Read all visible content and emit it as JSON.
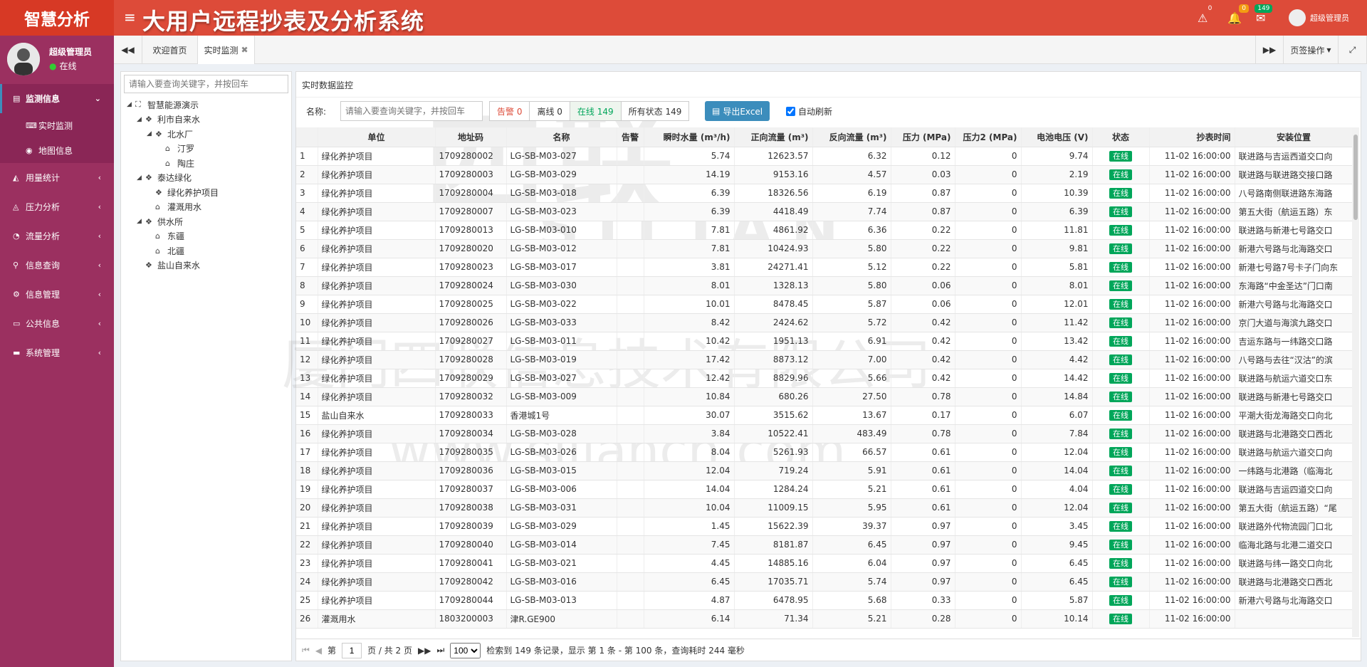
{
  "header": {
    "logo": "智慧分析",
    "title": "大用户远程抄表及分析系统",
    "user": "超级管理员",
    "badges": {
      "warn": "0",
      "bell": "0",
      "mail": "149"
    }
  },
  "sidebar": {
    "user_name": "超级管理员",
    "user_status": "在线",
    "items": [
      {
        "label": "监测信息",
        "icon": "book-icon",
        "active": true
      },
      {
        "label": "实时监测",
        "icon": "keyboard-icon",
        "sub": true
      },
      {
        "label": "地图信息",
        "icon": "globe-icon",
        "sub": true
      },
      {
        "label": "用量统计",
        "icon": "area-chart-icon"
      },
      {
        "label": "压力分析",
        "icon": "line-chart-icon"
      },
      {
        "label": "流量分析",
        "icon": "pie-chart-icon"
      },
      {
        "label": "信息查询",
        "icon": "search-icon"
      },
      {
        "label": "信息管理",
        "icon": "cogs-icon"
      },
      {
        "label": "公共信息",
        "icon": "hdd-icon"
      },
      {
        "label": "系统管理",
        "icon": "desktop-icon"
      }
    ]
  },
  "tabs": {
    "home": "欢迎首页",
    "current": "实时监测",
    "ops": "页签操作"
  },
  "tree": {
    "placeholder": "请输入要查询关键字，并按回车",
    "nodes": [
      {
        "label": "智慧能源演示",
        "level": 0,
        "toggle": "◢",
        "icon": "sitemap-icon"
      },
      {
        "label": "利市自来水",
        "level": 1,
        "toggle": "◢",
        "icon": "cubes-icon"
      },
      {
        "label": "北水厂",
        "level": 2,
        "toggle": "◢",
        "icon": "cubes-icon"
      },
      {
        "label": "汀罗",
        "level": 3,
        "toggle": "",
        "icon": "home-icon"
      },
      {
        "label": "陶庄",
        "level": 3,
        "toggle": "",
        "icon": "home-icon"
      },
      {
        "label": "泰达绿化",
        "level": 1,
        "toggle": "◢",
        "icon": "cubes-icon"
      },
      {
        "label": "绿化养护项目",
        "level": 2,
        "toggle": "",
        "icon": "cubes-icon"
      },
      {
        "label": "灌溉用水",
        "level": 2,
        "toggle": "",
        "icon": "home-icon"
      },
      {
        "label": "供水所",
        "level": 1,
        "toggle": "◢",
        "icon": "cubes-icon"
      },
      {
        "label": "东疆",
        "level": 2,
        "toggle": "",
        "icon": "home-icon"
      },
      {
        "label": "北疆",
        "level": 2,
        "toggle": "",
        "icon": "home-icon"
      },
      {
        "label": "盐山自来水",
        "level": 1,
        "toggle": "",
        "icon": "cubes-icon"
      }
    ]
  },
  "panel": {
    "title": "实时数据监控",
    "name_label": "名称:",
    "search_placeholder": "请输入要查询关键字，并按回车",
    "filters": [
      "告警 0",
      "离线 0",
      "在线 149",
      "所有状态 149"
    ],
    "export": "导出Excel",
    "auto_refresh": "自动刷新"
  },
  "table": {
    "headers": [
      "",
      "单位",
      "地址码",
      "名称",
      "告警",
      "瞬时水量 (m³/h)",
      "正向流量 (m³)",
      "反向流量 (m³)",
      "压力 (MPa)",
      "压力2 (MPa)",
      "电池电压 (V)",
      "状态",
      "抄表时间",
      "安装位置"
    ],
    "rows": [
      [
        "1",
        "绿化养护项目",
        "1709280002",
        "LG-SB-M03-027",
        "",
        "5.74",
        "12623.57",
        "6.32",
        "0.12",
        "0",
        "9.74",
        "在线",
        "11-02 16:00:00",
        "联进路与吉运西道交口向"
      ],
      [
        "2",
        "绿化养护项目",
        "1709280003",
        "LG-SB-M03-029",
        "",
        "14.19",
        "9153.16",
        "4.57",
        "0.03",
        "0",
        "2.19",
        "在线",
        "11-02 16:00:00",
        "联进路与联进路交接口路"
      ],
      [
        "3",
        "绿化养护项目",
        "1709280004",
        "LG-SB-M03-018",
        "",
        "6.39",
        "18326.56",
        "6.19",
        "0.87",
        "0",
        "10.39",
        "在线",
        "11-02 16:00:00",
        "八号路南侧联进路东海路"
      ],
      [
        "4",
        "绿化养护项目",
        "1709280007",
        "LG-SB-M03-023",
        "",
        "6.39",
        "4418.49",
        "7.74",
        "0.87",
        "0",
        "6.39",
        "在线",
        "11-02 16:00:00",
        "第五大街（航运五路）东"
      ],
      [
        "5",
        "绿化养护项目",
        "1709280013",
        "LG-SB-M03-010",
        "",
        "7.81",
        "4861.92",
        "6.36",
        "0.22",
        "0",
        "11.81",
        "在线",
        "11-02 16:00:00",
        "联进路与新港七号路交口"
      ],
      [
        "6",
        "绿化养护项目",
        "1709280020",
        "LG-SB-M03-012",
        "",
        "7.81",
        "10424.93",
        "5.80",
        "0.22",
        "0",
        "9.81",
        "在线",
        "11-02 16:00:00",
        "新港六号路与北海路交口"
      ],
      [
        "7",
        "绿化养护项目",
        "1709280023",
        "LG-SB-M03-017",
        "",
        "3.81",
        "24271.41",
        "5.12",
        "0.22",
        "0",
        "5.81",
        "在线",
        "11-02 16:00:00",
        "新港七号路7号卡子门向东"
      ],
      [
        "8",
        "绿化养护项目",
        "1709280024",
        "LG-SB-M03-030",
        "",
        "8.01",
        "1328.13",
        "5.80",
        "0.06",
        "0",
        "8.01",
        "在线",
        "11-02 16:00:00",
        "东海路“中金圣达”门口南"
      ],
      [
        "9",
        "绿化养护项目",
        "1709280025",
        "LG-SB-M03-022",
        "",
        "10.01",
        "8478.45",
        "5.87",
        "0.06",
        "0",
        "12.01",
        "在线",
        "11-02 16:00:00",
        "新港六号路与北海路交口"
      ],
      [
        "10",
        "绿化养护项目",
        "1709280026",
        "LG-SB-M03-033",
        "",
        "8.42",
        "2424.62",
        "5.72",
        "0.42",
        "0",
        "11.42",
        "在线",
        "11-02 16:00:00",
        "京门大道与海滨九路交口"
      ],
      [
        "11",
        "绿化养护项目",
        "1709280027",
        "LG-SB-M03-011",
        "",
        "10.42",
        "1951.13",
        "6.91",
        "0.42",
        "0",
        "13.42",
        "在线",
        "11-02 16:00:00",
        "吉运东路与一纬路交口路"
      ],
      [
        "12",
        "绿化养护项目",
        "1709280028",
        "LG-SB-M03-019",
        "",
        "17.42",
        "8873.12",
        "7.00",
        "0.42",
        "0",
        "4.42",
        "在线",
        "11-02 16:00:00",
        "八号路与去往“汉沽”的滨"
      ],
      [
        "13",
        "绿化养护项目",
        "1709280029",
        "LG-SB-M03-027",
        "",
        "12.42",
        "8829.96",
        "5.66",
        "0.42",
        "0",
        "14.42",
        "在线",
        "11-02 16:00:00",
        "联进路与航运六道交口东"
      ],
      [
        "14",
        "绿化养护项目",
        "1709280032",
        "LG-SB-M03-009",
        "",
        "10.84",
        "680.26",
        "27.50",
        "0.78",
        "0",
        "14.84",
        "在线",
        "11-02 16:00:00",
        "联进路与新港七号路交口"
      ],
      [
        "15",
        "盐山自来水",
        "1709280033",
        "香港城1号",
        "",
        "30.07",
        "3515.62",
        "13.67",
        "0.17",
        "0",
        "6.07",
        "在线",
        "11-02 16:00:00",
        "平潮大街龙海路交口向北"
      ],
      [
        "16",
        "绿化养护项目",
        "1709280034",
        "LG-SB-M03-028",
        "",
        "3.84",
        "10522.41",
        "483.49",
        "0.78",
        "0",
        "7.84",
        "在线",
        "11-02 16:00:00",
        "联进路与北港路交口西北"
      ],
      [
        "17",
        "绿化养护项目",
        "1709280035",
        "LG-SB-M03-026",
        "",
        "8.04",
        "5261.93",
        "66.57",
        "0.61",
        "0",
        "12.04",
        "在线",
        "11-02 16:00:00",
        "联进路与航运六道交口向"
      ],
      [
        "18",
        "绿化养护项目",
        "1709280036",
        "LG-SB-M03-015",
        "",
        "12.04",
        "719.24",
        "5.91",
        "0.61",
        "0",
        "14.04",
        "在线",
        "11-02 16:00:00",
        "一纬路与北港路（临海北"
      ],
      [
        "19",
        "绿化养护项目",
        "1709280037",
        "LG-SB-M03-006",
        "",
        "14.04",
        "1284.24",
        "5.21",
        "0.61",
        "0",
        "4.04",
        "在线",
        "11-02 16:00:00",
        "联进路与吉运四道交口向"
      ],
      [
        "20",
        "绿化养护项目",
        "1709280038",
        "LG-SB-M03-031",
        "",
        "10.04",
        "11009.15",
        "5.95",
        "0.61",
        "0",
        "12.04",
        "在线",
        "11-02 16:00:00",
        "第五大街（航运五路）“尾"
      ],
      [
        "21",
        "绿化养护项目",
        "1709280039",
        "LG-SB-M03-029",
        "",
        "1.45",
        "15622.39",
        "39.37",
        "0.97",
        "0",
        "3.45",
        "在线",
        "11-02 16:00:00",
        "联进路外代物流园门口北"
      ],
      [
        "22",
        "绿化养护项目",
        "1709280040",
        "LG-SB-M03-014",
        "",
        "7.45",
        "8181.87",
        "6.45",
        "0.97",
        "0",
        "9.45",
        "在线",
        "11-02 16:00:00",
        "临海北路与北港二道交口"
      ],
      [
        "23",
        "绿化养护项目",
        "1709280041",
        "LG-SB-M03-021",
        "",
        "4.45",
        "14885.16",
        "6.04",
        "0.97",
        "0",
        "6.45",
        "在线",
        "11-02 16:00:00",
        "联进路与纬一路交口向北"
      ],
      [
        "24",
        "绿化养护项目",
        "1709280042",
        "LG-SB-M03-016",
        "",
        "6.45",
        "17035.71",
        "5.74",
        "0.97",
        "0",
        "6.45",
        "在线",
        "11-02 16:00:00",
        "联进路与北港路交口西北"
      ],
      [
        "25",
        "绿化养护项目",
        "1709280044",
        "LG-SB-M03-013",
        "",
        "4.87",
        "6478.95",
        "5.68",
        "0.33",
        "0",
        "5.87",
        "在线",
        "11-02 16:00:00",
        "新港六号路与北海路交口"
      ],
      [
        "26",
        "灌溉用水",
        "1803200003",
        "津R.GE900",
        "",
        "6.14",
        "71.34",
        "5.21",
        "0.28",
        "0",
        "10.14",
        "在线",
        "11-02 16:00:00",
        ""
      ]
    ]
  },
  "pager": {
    "page_prefix": "第",
    "page": "1",
    "page_suffix": "页 / 共 2 页",
    "page_size": "100",
    "summary": "检索到 149 条记录，显示 第 1 条 - 第 100 条，查询耗时 244 毫秒"
  },
  "watermark": {
    "line1": "四联",
    "line2": "SILIAN",
    "line3": "厦门四联信息技术有限公司",
    "line4": "www.siliancn.com"
  }
}
